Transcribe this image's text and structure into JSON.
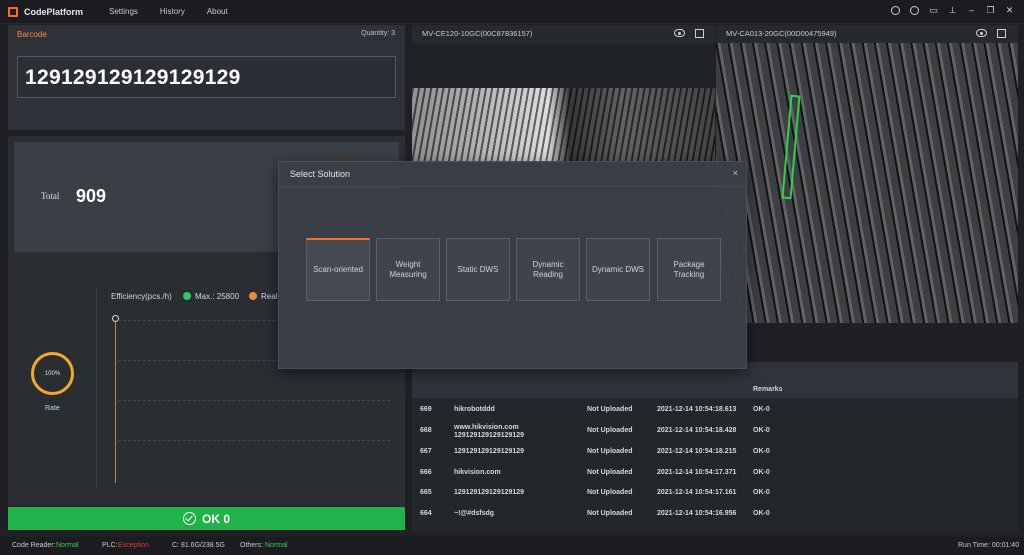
{
  "app": {
    "title": "CodePlatform",
    "menu": [
      "Settings",
      "History",
      "About"
    ]
  },
  "barcode": {
    "label": "Barcode",
    "quantity": "Quantity: 3",
    "value": "129129129129129129"
  },
  "total": {
    "label": "Total",
    "value": "909"
  },
  "efficiency": {
    "title": "Efficiency(pcs./h)",
    "max": "Max.: 25800",
    "real": "Real-"
  },
  "rate": {
    "percent": "100%",
    "label": "Rate"
  },
  "ok": {
    "label": "OK 0"
  },
  "cameras": [
    {
      "title": "MV-CE120-10GC(00C87836157)"
    },
    {
      "title": "MV-CA013-20GC(00D00475949)"
    }
  ],
  "table": {
    "remarks_header": "Remarks",
    "rows": [
      {
        "idx": "669",
        "code": "hikrobotddd",
        "status": "Not Uploaded",
        "time": "2021-12-14 10:54:18.613",
        "remark": "OK-0"
      },
      {
        "idx": "668",
        "code": "www.hikvision.com",
        "code2": "129129129129129129",
        "status": "Not Uploaded",
        "time": "2021-12-14 10:54:18.428",
        "remark": "OK-0"
      },
      {
        "idx": "667",
        "code": "129129129129129129",
        "status": "Not Uploaded",
        "time": "2021-12-14 10:54:18.215",
        "remark": "OK-0"
      },
      {
        "idx": "666",
        "code": "hikvision.com",
        "status": "Not Uploaded",
        "time": "2021-12-14 10:54:17.371",
        "remark": "OK-0"
      },
      {
        "idx": "665",
        "code": "129129129129129129",
        "status": "Not Uploaded",
        "time": "2021-12-14 10:54:17.161",
        "remark": "OK-0"
      },
      {
        "idx": "664",
        "code": "~!@#dsfsdg",
        "status": "Not Uploaded",
        "time": "2021-12-14 10:54:16.956",
        "remark": "OK-0"
      }
    ]
  },
  "status": {
    "code_reader_label": "Code Reader:",
    "code_reader_value": "Normal",
    "plc_label": "PLC:",
    "plc_value": "Exception",
    "disk": "C: 81.6G/238.5G",
    "others_label": "Others:",
    "others_value": "Normal",
    "run_time": "Run Time: 00:01:40"
  },
  "modal": {
    "title": "Select Solution",
    "close": "×",
    "options": [
      "Scan-oriented",
      "Weight Measuring",
      "Static DWS",
      "Dynamic Reading",
      "Dynamic DWS",
      "Package Tracking"
    ],
    "selected_index": 0
  },
  "colors": {
    "accent": "#ff6a2b",
    "ok_green": "#22b24c",
    "ring": "#f0a92a"
  }
}
